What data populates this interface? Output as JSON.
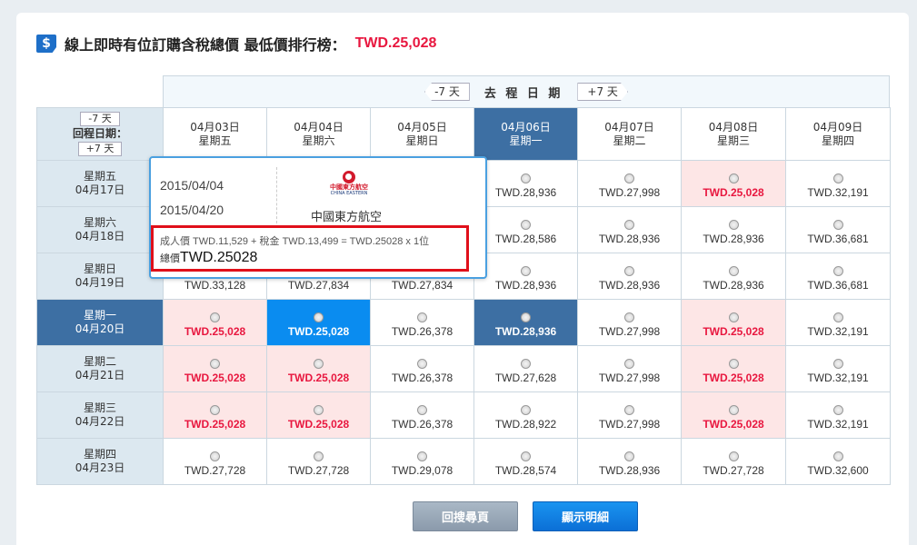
{
  "header": {
    "icon": "dollar-icon",
    "title": "線上即時有位訂購含稅總價 最低價排行榜：",
    "lowest_price": "TWD.25,028"
  },
  "depart_nav": {
    "prev": "-7 天",
    "label": "去 程 日 期",
    "next": "+7 天"
  },
  "return_nav": {
    "prev": "-7 天",
    "label": "回程日期：",
    "next": "+7 天"
  },
  "columns": [
    {
      "date": "04月03日",
      "weekday": "星期五",
      "selected": false
    },
    {
      "date": "04月04日",
      "weekday": "星期六",
      "selected": false
    },
    {
      "date": "04月05日",
      "weekday": "星期日",
      "selected": false
    },
    {
      "date": "04月06日",
      "weekday": "星期一",
      "selected": true
    },
    {
      "date": "04月07日",
      "weekday": "星期二",
      "selected": false
    },
    {
      "date": "04月08日",
      "weekday": "星期三",
      "selected": false
    },
    {
      "date": "04月09日",
      "weekday": "星期四",
      "selected": false
    }
  ],
  "rows": [
    {
      "weekday": "星期五",
      "date": "04月17日",
      "selected": false,
      "prices": [
        "",
        "",
        "",
        "TWD.28,936",
        "TWD.27,998",
        "TWD.25,028",
        "TWD.32,191"
      ],
      "low": [
        false,
        false,
        false,
        false,
        false,
        true,
        false
      ]
    },
    {
      "weekday": "星期六",
      "date": "04月18日",
      "selected": false,
      "prices": [
        "",
        "",
        "",
        "TWD.28,586",
        "TWD.28,936",
        "TWD.28,936",
        "TWD.36,681"
      ],
      "low": [
        false,
        false,
        false,
        false,
        false,
        false,
        false
      ]
    },
    {
      "weekday": "星期日",
      "date": "04月19日",
      "selected": false,
      "prices": [
        "TWD.33,128",
        "TWD.27,834",
        "TWD.27,834",
        "TWD.28,936",
        "TWD.28,936",
        "TWD.28,936",
        "TWD.36,681"
      ],
      "low": [
        false,
        false,
        false,
        false,
        false,
        false,
        false
      ]
    },
    {
      "weekday": "星期一",
      "date": "04月20日",
      "selected": true,
      "prices": [
        "TWD.25,028",
        "TWD.25,028",
        "TWD.26,378",
        "TWD.28,936",
        "TWD.27,998",
        "TWD.25,028",
        "TWD.32,191"
      ],
      "low": [
        true,
        true,
        false,
        false,
        false,
        true,
        false
      ]
    },
    {
      "weekday": "星期二",
      "date": "04月21日",
      "selected": false,
      "prices": [
        "TWD.25,028",
        "TWD.25,028",
        "TWD.26,378",
        "TWD.27,628",
        "TWD.27,998",
        "TWD.25,028",
        "TWD.32,191"
      ],
      "low": [
        true,
        true,
        false,
        false,
        false,
        true,
        false
      ]
    },
    {
      "weekday": "星期三",
      "date": "04月22日",
      "selected": false,
      "prices": [
        "TWD.25,028",
        "TWD.25,028",
        "TWD.26,378",
        "TWD.28,922",
        "TWD.27,998",
        "TWD.25,028",
        "TWD.32,191"
      ],
      "low": [
        true,
        true,
        false,
        false,
        false,
        true,
        false
      ]
    },
    {
      "weekday": "星期四",
      "date": "04月23日",
      "selected": false,
      "prices": [
        "TWD.27,728",
        "TWD.27,728",
        "TWD.29,078",
        "TWD.28,574",
        "TWD.28,936",
        "TWD.27,728",
        "TWD.32,600"
      ],
      "low": [
        false,
        false,
        false,
        false,
        false,
        false,
        false
      ]
    }
  ],
  "selected_cell": {
    "row": 3,
    "col": 1
  },
  "popup": {
    "depart_date": "2015/04/04",
    "return_date": "2015/04/20",
    "airline_logo_cn": "中國東方航空",
    "airline_logo_en": "CHINA EASTERN",
    "airline": "中國東方航空",
    "breakdown": "成人價 TWD.11,529 + 稅金 TWD.13,499 = TWD.25028 x 1位",
    "total_label": "總價",
    "total_value": "TWD.25028"
  },
  "buttons": {
    "back": "回搜尋頁",
    "detail": "顯示明細"
  },
  "colors": {
    "accent": "#e8173f",
    "selected": "#3d6fa3",
    "active": "#0a8cf0",
    "low_bg": "#fde6e6"
  }
}
